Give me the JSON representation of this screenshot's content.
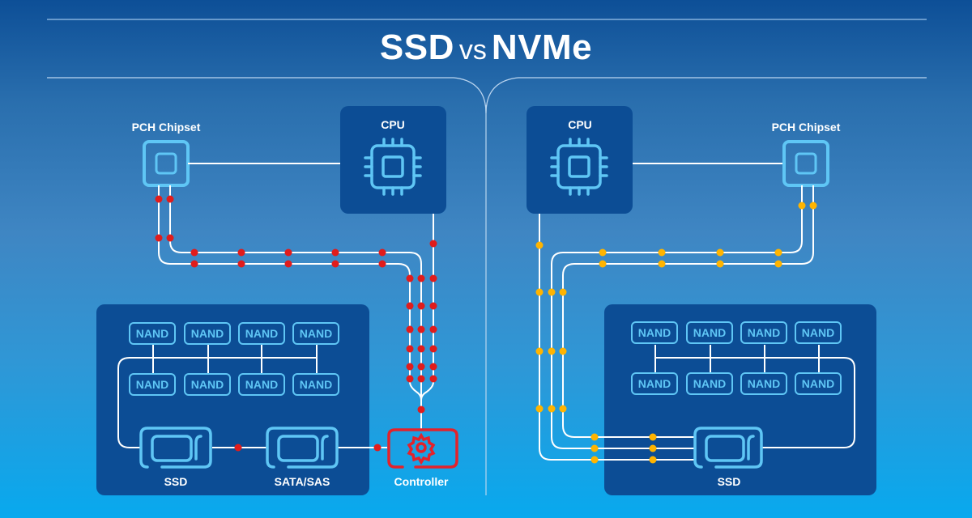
{
  "title": {
    "primary": "SSD",
    "connector": "vs",
    "secondary": "NVMe"
  },
  "colors": {
    "panel": "#0c4d95",
    "icon_outline": "#5fc6f5",
    "line": "#ffffff",
    "ssd_lane_dot": "#e01c1c",
    "nvme_lane_dot": "#ffb400",
    "controller": "#e3222b"
  },
  "left": {
    "name": "SSD",
    "pch_label": "PCH Chipset",
    "cpu_label": "CPU",
    "nand_chips": [
      "NAND",
      "NAND",
      "NAND",
      "NAND",
      "NAND",
      "NAND",
      "NAND",
      "NAND"
    ],
    "ssd_label": "SSD",
    "interface_label": "SATA/SAS",
    "controller_label": "Controller"
  },
  "right": {
    "name": "NVMe",
    "cpu_label": "CPU",
    "pch_label": "PCH Chipset",
    "nand_chips": [
      "NAND",
      "NAND",
      "NAND",
      "NAND",
      "NAND",
      "NAND",
      "NAND",
      "NAND"
    ],
    "ssd_label": "SSD"
  }
}
